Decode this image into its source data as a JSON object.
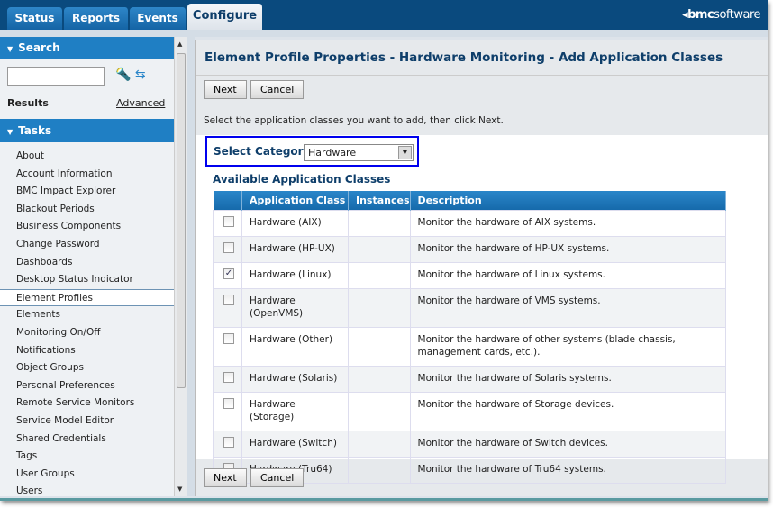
{
  "tabs": [
    {
      "label": "Status"
    },
    {
      "label": "Reports"
    },
    {
      "label": "Events"
    },
    {
      "label": "Configure"
    }
  ],
  "logo": {
    "mark": "bmc",
    "text": "software"
  },
  "sidebar": {
    "search_header": "Search",
    "search_value": "",
    "results_label": "Results",
    "advanced_link": "Advanced",
    "tasks_header": "Tasks",
    "tasks": [
      "About",
      "Account Information",
      "BMC Impact Explorer",
      "Blackout Periods",
      "Business Components",
      "Change Password",
      "Dashboards",
      "Desktop Status Indicator",
      "Element Profiles",
      "Elements",
      "Monitoring On/Off",
      "Notifications",
      "Object Groups",
      "Personal Preferences",
      "Remote Service Monitors",
      "Service Model Editor",
      "Shared Credentials",
      "Tags",
      "User Groups",
      "Users"
    ],
    "selected": "Element Profiles"
  },
  "main": {
    "title": "Element Profile Properties - Hardware Monitoring - Add Application Classes",
    "next": "Next",
    "cancel": "Cancel",
    "instruction": "Select the application classes you want to add, then click Next.",
    "category_label": "Select Category",
    "category_value": "Hardware",
    "available_heading": "Available Application Classes",
    "columns": [
      "",
      "Application Class",
      "Instances",
      "Description"
    ],
    "rows": [
      {
        "checked": false,
        "class": "Hardware (AIX)",
        "instances": "",
        "description": "Monitor the hardware of AIX systems."
      },
      {
        "checked": false,
        "class": "Hardware (HP-UX)",
        "instances": "",
        "description": "Monitor the hardware of HP-UX systems."
      },
      {
        "checked": true,
        "class": "Hardware (Linux)",
        "instances": "",
        "description": "Monitor the hardware of Linux systems."
      },
      {
        "checked": false,
        "class": "Hardware (OpenVMS)",
        "instances": "",
        "description": "Monitor the hardware of VMS systems."
      },
      {
        "checked": false,
        "class": "Hardware (Other)",
        "instances": "",
        "description": "Monitor the hardware of other systems (blade chassis, management cards, etc.)."
      },
      {
        "checked": false,
        "class": "Hardware (Solaris)",
        "instances": "",
        "description": "Monitor the hardware of Solaris systems."
      },
      {
        "checked": false,
        "class": "Hardware (Storage)",
        "instances": "",
        "description": "Monitor the hardware of Storage devices."
      },
      {
        "checked": false,
        "class": "Hardware (Switch)",
        "instances": "",
        "description": "Monitor the hardware of Switch devices."
      },
      {
        "checked": false,
        "class": "Hardware (Tru64)",
        "instances": "",
        "description": "Monitor the hardware of Tru64 systems."
      }
    ]
  }
}
